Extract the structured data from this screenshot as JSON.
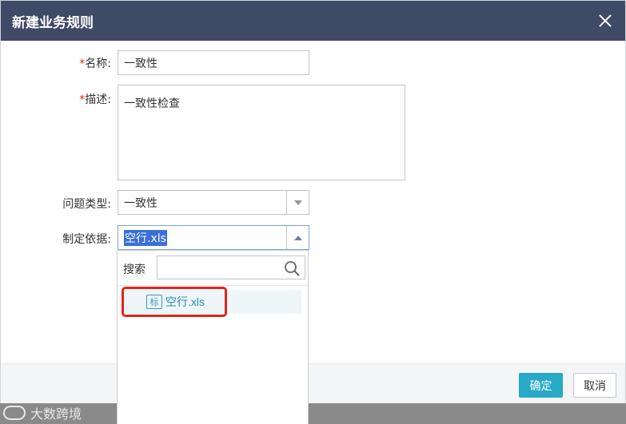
{
  "dialog": {
    "title": "新建业务规则",
    "close_label": "close"
  },
  "form": {
    "name": {
      "required_mark": "*",
      "label": "名称:",
      "value": "一致性"
    },
    "description": {
      "required_mark": "*",
      "label": "描述:",
      "value": "一致性检查"
    },
    "issue_type": {
      "label": "问题类型:",
      "value": "一致性"
    },
    "basis": {
      "label": "制定依据:",
      "value": "空行.xls"
    }
  },
  "dropdown": {
    "search_label": "搜索",
    "search_placeholder": "",
    "items": [
      {
        "icon_text": "标",
        "label": "空行.xls",
        "icon": "file-tag-icon"
      }
    ]
  },
  "footer": {
    "ok_label": "确定",
    "cancel_label": "取消"
  },
  "watermark": {
    "text": "大数跨境"
  },
  "colors": {
    "header_bg": "#3f4a66",
    "primary_button": "#28a9c7",
    "required": "#e02020",
    "highlight": "#e2241c",
    "selection": "#3a6fd8"
  }
}
